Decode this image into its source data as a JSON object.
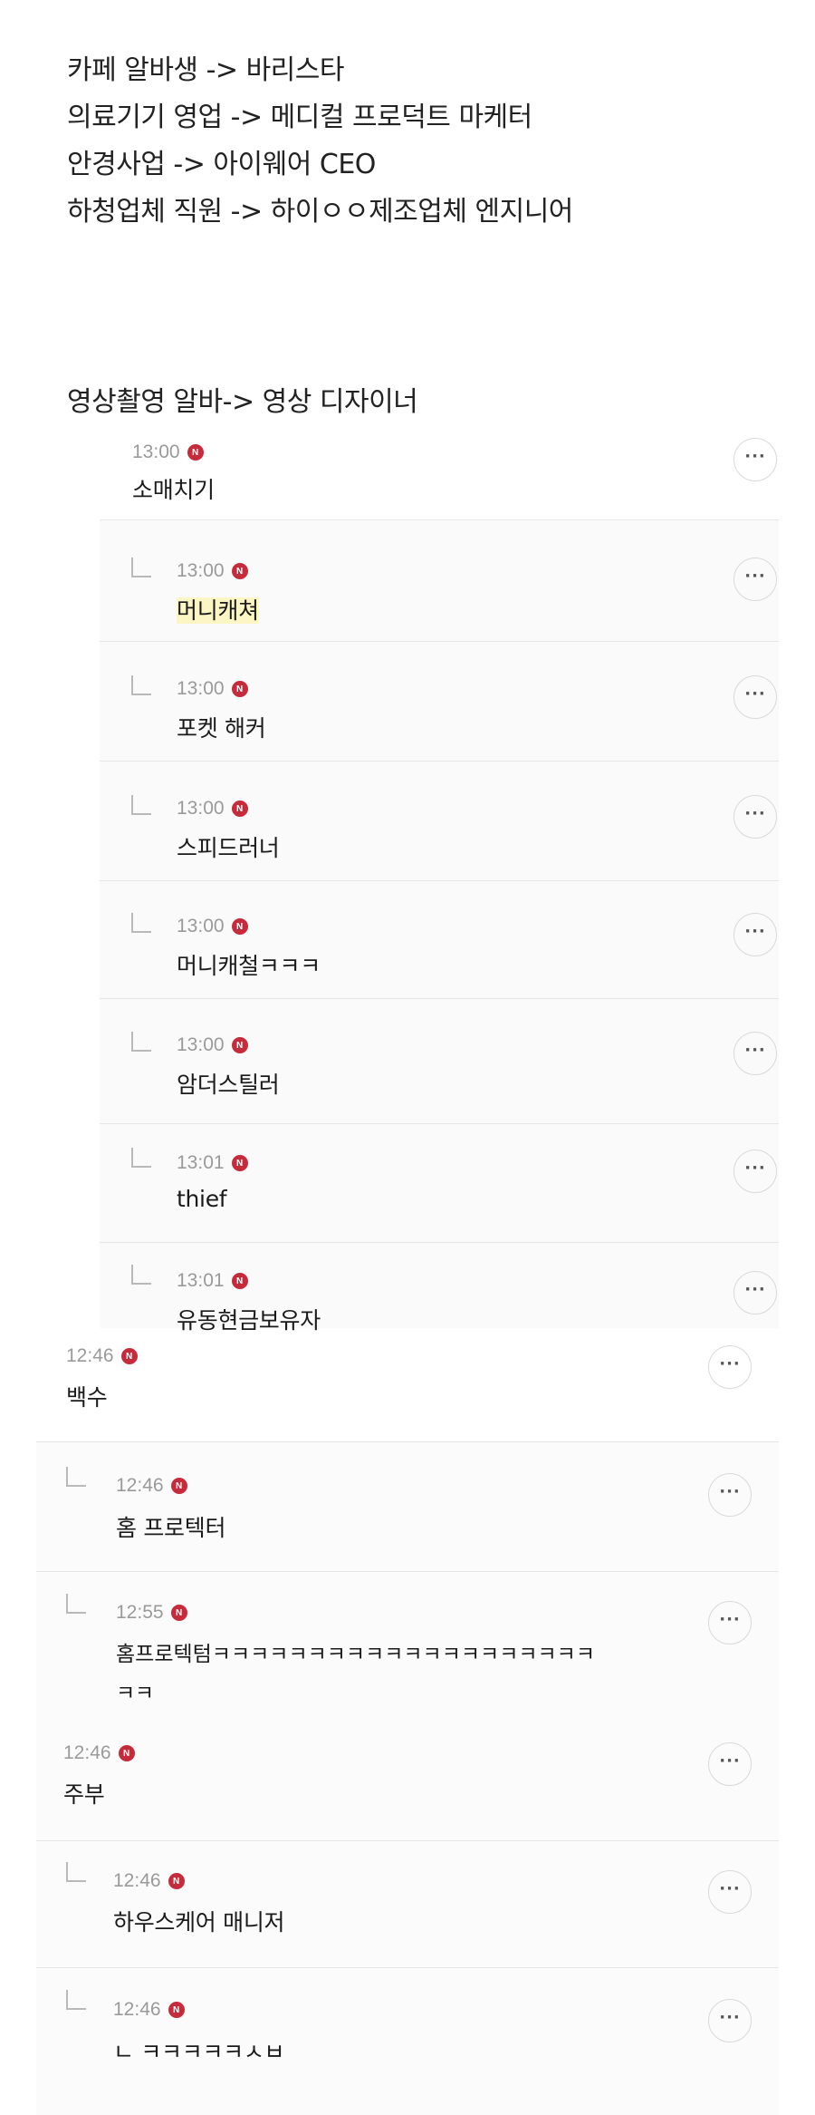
{
  "intro": [
    "카페 알바생 -> 바리스타",
    "의료기기 영업 -> 메디컬 프로덕트 마케터",
    "안경사업 -> 아이웨어 CEO",
    "하청업체 직원 -> 하이ㅇㅇ제조업체 엔지니어"
  ],
  "heading": "영상촬영 알바-> 영상 디자이너",
  "badge_letter": "N",
  "more_label": "···",
  "comments": [
    {
      "time": "13:00",
      "text": "소매치기"
    },
    {
      "time": "13:00",
      "text": "머니캐쳐"
    },
    {
      "time": "13:00",
      "text": "포켓 해커"
    },
    {
      "time": "13:00",
      "text": "스피드러너"
    },
    {
      "time": "13:00",
      "text": "머니캐철ㅋㅋㅋ"
    },
    {
      "time": "13:00",
      "text": "암더스틸러"
    },
    {
      "time": "13:01",
      "text": "thief"
    },
    {
      "time": "13:01",
      "text": "유동현금보유자"
    },
    {
      "time": "12:46",
      "text": "백수"
    },
    {
      "time": "12:46",
      "text": "홈 프로텍터"
    },
    {
      "time": "12:55",
      "text": "홈프로텍텀ㅋㅋㅋㅋㅋㅋㅋㅋㅋㅋㅋㅋㅋㅋㅋㅋㅋㅋㅋㅋ",
      "text2": "ㅋㅋ"
    },
    {
      "time": "12:46",
      "text": "주부"
    },
    {
      "time": "12:46",
      "text": "하우스케어 매니저"
    },
    {
      "time": "12:46",
      "text": "ㄴ ㅋㅋㅋㅋㅋㅅㅂ"
    }
  ],
  "colors": {
    "badge": "#c62b3b",
    "time": "#9a9a9a",
    "highlight": "#fbf6c4"
  }
}
